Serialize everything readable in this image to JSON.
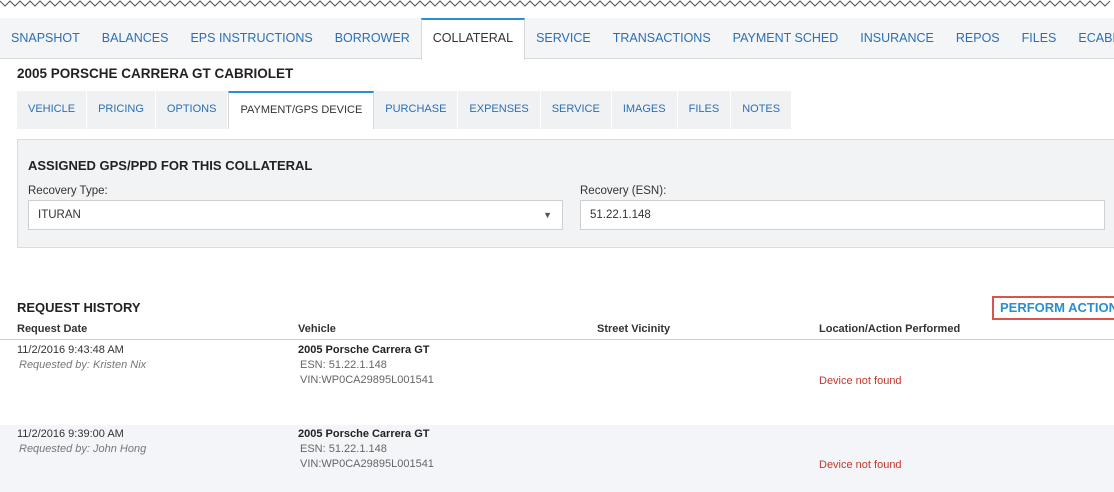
{
  "top_tabs": [
    "SNAPSHOT",
    "BALANCES",
    "EPS INSTRUCTIONS",
    "BORROWER",
    "COLLATERAL",
    "SERVICE",
    "TRANSACTIONS",
    "PAYMENT SCHED",
    "INSURANCE",
    "REPOS",
    "FILES",
    "ECABINET"
  ],
  "active_top_tab": "COLLATERAL",
  "vehicle_title": "2005 PORSCHE CARRERA GT CABRIOLET",
  "sub_tabs": [
    "VEHICLE",
    "PRICING",
    "OPTIONS",
    "PAYMENT/GPS DEVICE",
    "PURCHASE",
    "EXPENSES",
    "SERVICE",
    "IMAGES",
    "FILES",
    "NOTES"
  ],
  "active_sub_tab": "PAYMENT/GPS DEVICE",
  "gps": {
    "title": "ASSIGNED GPS/PPD FOR THIS COLLATERAL",
    "recovery_type_label": "Recovery Type:",
    "recovery_type_value": "ITURAN",
    "recovery_esn_label": "Recovery (ESN):",
    "recovery_esn_value": "51.22.1.148"
  },
  "history": {
    "title": "REQUEST HISTORY",
    "perform_action": "PERFORM ACTION",
    "columns": [
      "Request Date",
      "Vehicle",
      "Street Vicinity",
      "Location/Action Performed"
    ],
    "rows": [
      {
        "date": "11/2/2016 9:43:48 AM",
        "requested_by": "Requested by: Kristen Nix",
        "vehicle": "2005 Porsche Carrera GT",
        "esn": "ESN: 51.22.1.148",
        "vin": "VIN:WP0CA29895L001541",
        "street": "",
        "location": "Device not found"
      },
      {
        "date": "11/2/2016 9:39:00 AM",
        "requested_by": "Requested by: John Hong",
        "vehicle": "2005 Porsche Carrera GT",
        "esn": "ESN: 51.22.1.148",
        "vin": "VIN:WP0CA29895L001541",
        "street": "",
        "location": "Device not found"
      }
    ]
  },
  "colors": {
    "link": "#2a6fb6",
    "accent": "#2a8fd0",
    "error": "#c0392b",
    "highlight_border": "#d9534f"
  }
}
